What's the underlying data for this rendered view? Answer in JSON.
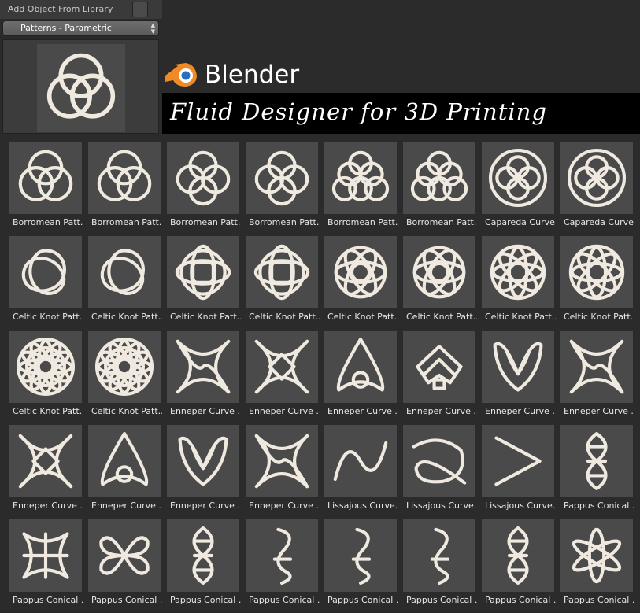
{
  "panel": {
    "header_title": "Add Object From Library",
    "library_select": "Patterns - Parametric",
    "preview_icon": "borromean-rings-icon"
  },
  "banner": {
    "brand": "Blender",
    "title": "Fluid Designer for 3D Printing",
    "brand_logo": "blender-logo-icon",
    "brand_colors": {
      "orange": "#f08a24",
      "blue": "#2b6fc1",
      "white": "#ffffff"
    }
  },
  "library_items": [
    {
      "label": "Borromean Patt...",
      "icon": "borromean"
    },
    {
      "label": "Borromean Patt...",
      "icon": "borromean"
    },
    {
      "label": "Borromean Patt...",
      "icon": "borromean4"
    },
    {
      "label": "Borromean Patt...",
      "icon": "borromean4"
    },
    {
      "label": "Borromean Patt...",
      "icon": "borromean6"
    },
    {
      "label": "Borromean Patt...",
      "icon": "borromean6"
    },
    {
      "label": "Capareda Curve...",
      "icon": "capareda"
    },
    {
      "label": "Capareda Curve...",
      "icon": "capareda"
    },
    {
      "label": "Celtic Knot Patt...",
      "icon": "trefoil"
    },
    {
      "label": "Celtic Knot Patt...",
      "icon": "trefoil"
    },
    {
      "label": "Celtic Knot Patt...",
      "icon": "celtic4"
    },
    {
      "label": "Celtic Knot Patt...",
      "icon": "celtic4"
    },
    {
      "label": "Celtic Knot Patt...",
      "icon": "celtic6"
    },
    {
      "label": "Celtic Knot Patt...",
      "icon": "celtic6"
    },
    {
      "label": "Celtic Knot Patt...",
      "icon": "celtic8"
    },
    {
      "label": "Celtic Knot Patt...",
      "icon": "celtic8"
    },
    {
      "label": "Celtic Knot Patt...",
      "icon": "celtic12"
    },
    {
      "label": "Celtic Knot Patt...",
      "icon": "celtic12"
    },
    {
      "label": "Enneper Curve ...",
      "icon": "enneper4"
    },
    {
      "label": "Enneper Curve ...",
      "icon": "enneper4b"
    },
    {
      "label": "Enneper Curve ...",
      "icon": "enneper3"
    },
    {
      "label": "Enneper Curve ...",
      "icon": "enneper2"
    },
    {
      "label": "Enneper Curve ...",
      "icon": "butterfly"
    },
    {
      "label": "Enneper Curve ...",
      "icon": "enneper4"
    },
    {
      "label": "Enneper Curve ...",
      "icon": "enneper4b"
    },
    {
      "label": "Enneper Curve ...",
      "icon": "enneper3"
    },
    {
      "label": "Enneper Curve ...",
      "icon": "butterfly"
    },
    {
      "label": "Enneper Curve ...",
      "icon": "enneper4"
    },
    {
      "label": "Lissajous Curve...",
      "icon": "lissajous-m"
    },
    {
      "label": "Lissajous Curve...",
      "icon": "lissajous-loop"
    },
    {
      "label": "Lissajous Curve...",
      "icon": "lissajous-v"
    },
    {
      "label": "Pappus Conical ...",
      "icon": "pappus-helix"
    },
    {
      "label": "Pappus Conical ...",
      "icon": "pappus-wide"
    },
    {
      "label": "Pappus Conical ...",
      "icon": "pappus-bow"
    },
    {
      "label": "Pappus Conical ...",
      "icon": "pappus-helix"
    },
    {
      "label": "Pappus Conical ...",
      "icon": "pappus-s"
    },
    {
      "label": "Pappus Conical ...",
      "icon": "pappus-s"
    },
    {
      "label": "Pappus Conical ...",
      "icon": "pappus-s"
    },
    {
      "label": "Pappus Conical ...",
      "icon": "pappus-helix"
    },
    {
      "label": "Pappus Conical ...",
      "icon": "pappus-flower"
    }
  ]
}
